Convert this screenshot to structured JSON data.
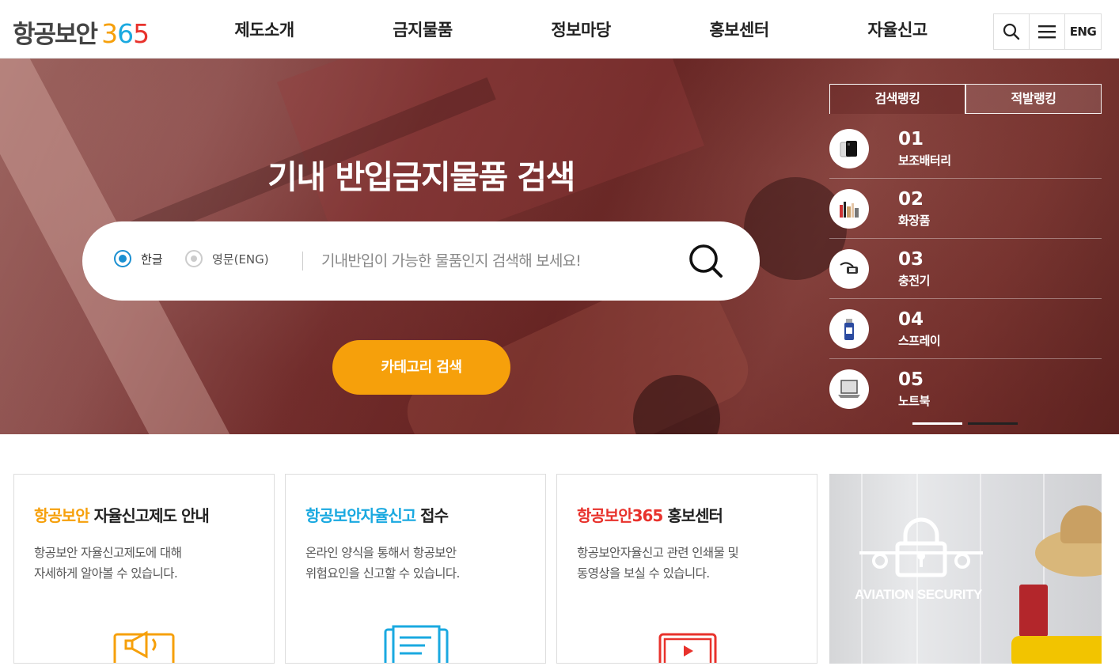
{
  "header": {
    "logo_korean": "항공보안",
    "logo_number_digits": [
      {
        "char": "3",
        "color": "#f6a00b"
      },
      {
        "char": "6",
        "color": "#1aa9e0"
      },
      {
        "char": "5",
        "color": "#e8322c"
      }
    ],
    "nav": [
      "제도소개",
      "금지물품",
      "정보마당",
      "홍보센터",
      "자율신고"
    ],
    "lang_button": "ENG"
  },
  "hero": {
    "title": "기내 반입금지물품 검색",
    "radio_korean": "한글",
    "radio_english": "영문(ENG)",
    "search_placeholder": "기내반입이 가능한 물품인지 검색해 보세요!",
    "category_button": "카테고리 검색"
  },
  "ranking": {
    "tabs": [
      "검색랭킹",
      "적발랭킹"
    ],
    "items": [
      {
        "rank": "01",
        "name": "보조배터리",
        "icon": "power-bank-icon"
      },
      {
        "rank": "02",
        "name": "화장품",
        "icon": "cosmetics-icon"
      },
      {
        "rank": "03",
        "name": "충전기",
        "icon": "charger-icon"
      },
      {
        "rank": "04",
        "name": "스프레이",
        "icon": "spray-icon"
      },
      {
        "rank": "05",
        "name": "노트북",
        "icon": "laptop-icon"
      }
    ]
  },
  "cards": [
    {
      "title_highlight": "항공보안",
      "title_highlight_color": "#f6a00b",
      "title_rest": "자율신고제도 안내",
      "desc": [
        "항공보안 자율신고제도에 대해",
        "자세하게 알아볼 수 있습니다."
      ],
      "icon": "megaphone-icon",
      "icon_color": "#f6a00b"
    },
    {
      "title_highlight": "항공보안자율신고",
      "title_highlight_color": "#1aa9e0",
      "title_rest": "접수",
      "desc": [
        "온라인 양식을 통해서 항공보안",
        "위험요인을 신고할 수 있습니다."
      ],
      "icon": "report-form-icon",
      "icon_color": "#1aa9e0"
    },
    {
      "title_highlight": "항공보안365",
      "title_highlight_color": "#e8322c",
      "title_rest": "홍보센터",
      "desc": [
        "항공보안자율신고 관련 인쇄물 및",
        "동영상을 보실 수 있습니다."
      ],
      "icon": "video-icon",
      "icon_color": "#e8322c"
    }
  ],
  "promo": {
    "text": "AVIATION SECURITY"
  }
}
